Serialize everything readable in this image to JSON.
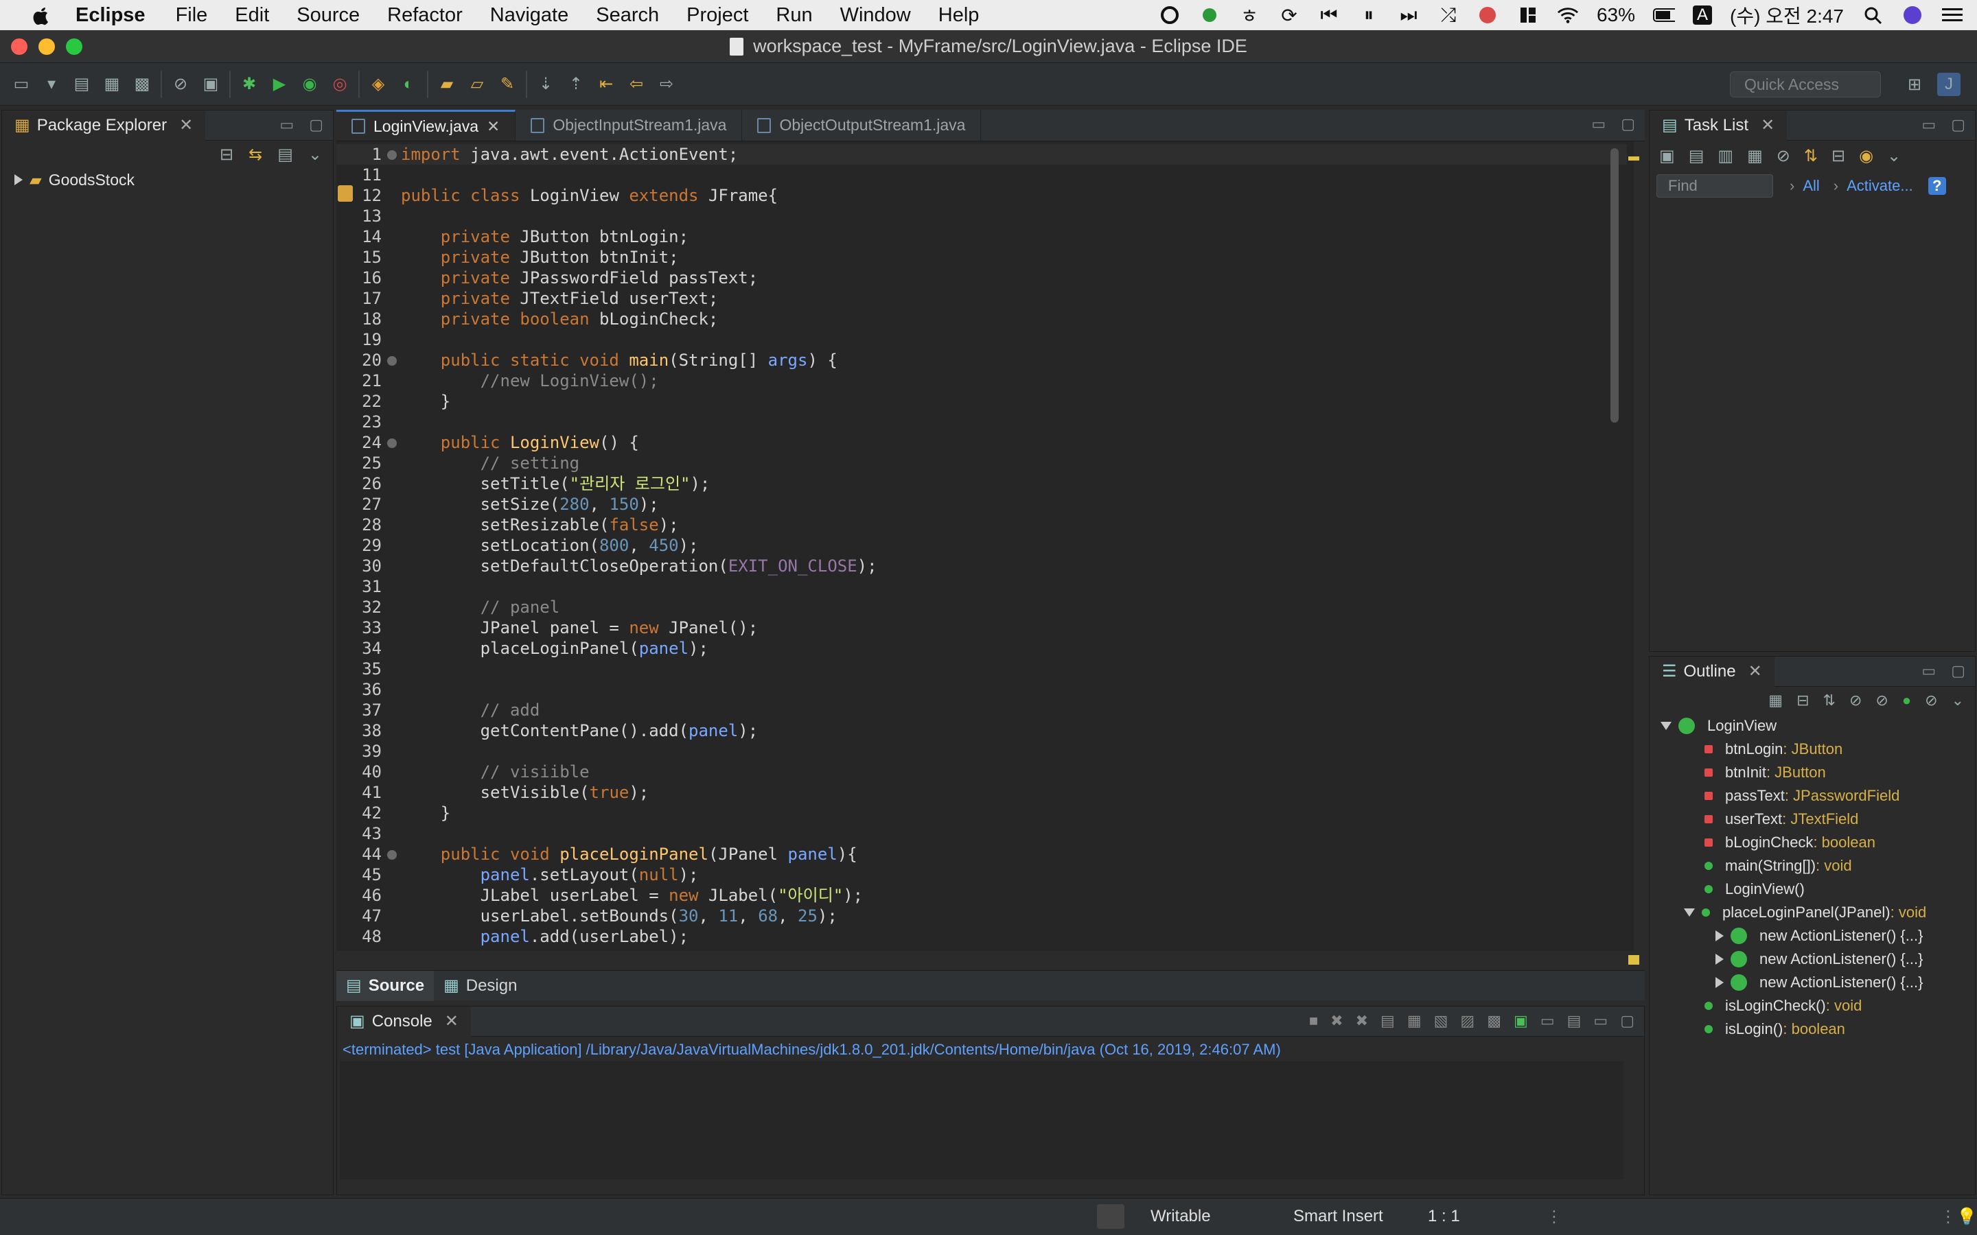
{
  "menubar": {
    "app_name": "Eclipse",
    "menus": [
      "File",
      "Edit",
      "Source",
      "Refactor",
      "Navigate",
      "Search",
      "Project",
      "Run",
      "Window",
      "Help"
    ],
    "battery": "63%",
    "input_source": "A",
    "clock": "(수) 오전 2:47"
  },
  "window": {
    "title": "workspace_test - MyFrame/src/LoginView.java - Eclipse IDE"
  },
  "toolbar": {
    "quick_access_placeholder": "Quick Access"
  },
  "package_explorer": {
    "title": "Package Explorer",
    "project": "GoodsStock"
  },
  "editor": {
    "tabs": [
      "LoginView.java",
      "ObjectInputStream1.java",
      "ObjectOutputStream1.java"
    ],
    "active_tab": 0,
    "bottom_tabs": [
      "Source",
      "Design"
    ],
    "lines": [
      {
        "n": "1",
        "fold": true,
        "tokens": [
          [
            "kw",
            "import"
          ],
          [
            "code",
            " java.awt.event.ActionEvent;"
          ]
        ]
      },
      {
        "n": "11",
        "tokens": []
      },
      {
        "n": "12",
        "tokens": [
          [
            "kw",
            "public class "
          ],
          [
            "code",
            "LoginView "
          ],
          [
            "kw",
            "extends "
          ],
          [
            "code",
            "JFrame{"
          ]
        ]
      },
      {
        "n": "13",
        "tokens": []
      },
      {
        "n": "14",
        "tokens": [
          [
            "code",
            "    "
          ],
          [
            "kw",
            "private "
          ],
          [
            "code",
            "JButton btnLogin;"
          ]
        ]
      },
      {
        "n": "15",
        "tokens": [
          [
            "code",
            "    "
          ],
          [
            "kw",
            "private "
          ],
          [
            "code",
            "JButton btnInit;"
          ]
        ]
      },
      {
        "n": "16",
        "tokens": [
          [
            "code",
            "    "
          ],
          [
            "kw",
            "private "
          ],
          [
            "code",
            "JPasswordField passText;"
          ]
        ]
      },
      {
        "n": "17",
        "tokens": [
          [
            "code",
            "    "
          ],
          [
            "kw",
            "private "
          ],
          [
            "code",
            "JTextField userText;"
          ]
        ]
      },
      {
        "n": "18",
        "tokens": [
          [
            "code",
            "    "
          ],
          [
            "kw",
            "private boolean "
          ],
          [
            "code",
            "bLoginCheck;"
          ]
        ]
      },
      {
        "n": "19",
        "tokens": []
      },
      {
        "n": "20",
        "fold": true,
        "tokens": [
          [
            "code",
            "    "
          ],
          [
            "kw",
            "public static void "
          ],
          [
            "fn",
            "main"
          ],
          [
            "code",
            "(String[] "
          ],
          [
            "par",
            "args"
          ],
          [
            "code",
            ") {"
          ]
        ]
      },
      {
        "n": "21",
        "tokens": [
          [
            "cm",
            "        //new LoginView();"
          ]
        ]
      },
      {
        "n": "22",
        "tokens": [
          [
            "code",
            "    }"
          ]
        ]
      },
      {
        "n": "23",
        "tokens": []
      },
      {
        "n": "24",
        "fold": true,
        "tokens": [
          [
            "code",
            "    "
          ],
          [
            "kw",
            "public "
          ],
          [
            "fn",
            "LoginView"
          ],
          [
            "code",
            "() {"
          ]
        ]
      },
      {
        "n": "25",
        "tokens": [
          [
            "cm",
            "        // setting"
          ]
        ]
      },
      {
        "n": "26",
        "tokens": [
          [
            "code",
            "        setTitle("
          ],
          [
            "str",
            "\"관리자 로그인\""
          ],
          [
            "code",
            ");"
          ]
        ]
      },
      {
        "n": "27",
        "tokens": [
          [
            "code",
            "        setSize("
          ],
          [
            "num",
            "280"
          ],
          [
            "code",
            ", "
          ],
          [
            "num",
            "150"
          ],
          [
            "code",
            ");"
          ]
        ]
      },
      {
        "n": "28",
        "tokens": [
          [
            "code",
            "        setResizable("
          ],
          [
            "kw",
            "false"
          ],
          [
            "code",
            ");"
          ]
        ]
      },
      {
        "n": "29",
        "tokens": [
          [
            "code",
            "        setLocation("
          ],
          [
            "num",
            "800"
          ],
          [
            "code",
            ", "
          ],
          [
            "num",
            "450"
          ],
          [
            "code",
            ");"
          ]
        ]
      },
      {
        "n": "30",
        "tokens": [
          [
            "code",
            "        setDefaultCloseOperation("
          ],
          [
            "fld",
            "EXIT_ON_CLOSE"
          ],
          [
            "code",
            ");"
          ]
        ]
      },
      {
        "n": "31",
        "tokens": []
      },
      {
        "n": "32",
        "tokens": [
          [
            "cm",
            "        // panel"
          ]
        ]
      },
      {
        "n": "33",
        "tokens": [
          [
            "code",
            "        JPanel panel = "
          ],
          [
            "kw",
            "new "
          ],
          [
            "code",
            "JPanel();"
          ]
        ]
      },
      {
        "n": "34",
        "tokens": [
          [
            "code",
            "        placeLoginPanel("
          ],
          [
            "par",
            "panel"
          ],
          [
            "code",
            ");"
          ]
        ]
      },
      {
        "n": "35",
        "tokens": []
      },
      {
        "n": "36",
        "tokens": []
      },
      {
        "n": "37",
        "tokens": [
          [
            "cm",
            "        // add"
          ]
        ]
      },
      {
        "n": "38",
        "tokens": [
          [
            "code",
            "        getContentPane().add("
          ],
          [
            "par",
            "panel"
          ],
          [
            "code",
            ");"
          ]
        ]
      },
      {
        "n": "39",
        "tokens": []
      },
      {
        "n": "40",
        "tokens": [
          [
            "cm",
            "        // visiible"
          ]
        ]
      },
      {
        "n": "41",
        "tokens": [
          [
            "code",
            "        setVisible("
          ],
          [
            "kw",
            "true"
          ],
          [
            "code",
            ");"
          ]
        ]
      },
      {
        "n": "42",
        "tokens": [
          [
            "code",
            "    }"
          ]
        ]
      },
      {
        "n": "43",
        "tokens": []
      },
      {
        "n": "44",
        "fold": true,
        "tokens": [
          [
            "code",
            "    "
          ],
          [
            "kw",
            "public void "
          ],
          [
            "fn",
            "placeLoginPanel"
          ],
          [
            "code",
            "(JPanel "
          ],
          [
            "par",
            "panel"
          ],
          [
            "code",
            "){"
          ]
        ]
      },
      {
        "n": "45",
        "tokens": [
          [
            "par",
            "        panel"
          ],
          [
            "code",
            ".setLayout("
          ],
          [
            "kw",
            "null"
          ],
          [
            "code",
            ");"
          ]
        ]
      },
      {
        "n": "46",
        "tokens": [
          [
            "code",
            "        JLabel userLabel = "
          ],
          [
            "kw",
            "new "
          ],
          [
            "code",
            "JLabel("
          ],
          [
            "str",
            "\"아이디\""
          ],
          [
            "code",
            ");"
          ]
        ]
      },
      {
        "n": "47",
        "tokens": [
          [
            "code",
            "        userLabel.setBounds("
          ],
          [
            "num",
            "30"
          ],
          [
            "code",
            ", "
          ],
          [
            "num",
            "11"
          ],
          [
            "code",
            ", "
          ],
          [
            "num",
            "68"
          ],
          [
            "code",
            ", "
          ],
          [
            "num",
            "25"
          ],
          [
            "code",
            ");"
          ]
        ]
      },
      {
        "n": "48",
        "tokens": [
          [
            "par",
            "        panel"
          ],
          [
            "code",
            ".add(userLabel);"
          ]
        ]
      }
    ]
  },
  "task_list": {
    "title": "Task List",
    "find_placeholder": "Find",
    "all_label": "All",
    "activate_label": "Activate..."
  },
  "outline": {
    "title": "Outline",
    "items": [
      {
        "label": "LoginView",
        "type": "",
        "kind": "class",
        "caret": "down"
      },
      {
        "label": "btnLogin",
        "type": " : JButton",
        "kind": "field"
      },
      {
        "label": "btnInit",
        "type": " : JButton",
        "kind": "field"
      },
      {
        "label": "passText",
        "type": " : JPasswordField",
        "kind": "field"
      },
      {
        "label": "userText",
        "type": " : JTextField",
        "kind": "field"
      },
      {
        "label": "bLoginCheck",
        "type": " : boolean",
        "kind": "field"
      },
      {
        "label": "main(String[])",
        "type": " : void",
        "kind": "method"
      },
      {
        "label": "LoginView()",
        "type": "",
        "kind": "method"
      },
      {
        "label": "placeLoginPanel(JPanel)",
        "type": " : void",
        "kind": "method",
        "caret": "down"
      },
      {
        "label": "new ActionListener() {...}",
        "type": "",
        "kind": "anon",
        "caret": "right"
      },
      {
        "label": "new ActionListener() {...}",
        "type": "",
        "kind": "anon",
        "caret": "right"
      },
      {
        "label": "new ActionListener() {...}",
        "type": "",
        "kind": "anon",
        "caret": "right"
      },
      {
        "label": "isLoginCheck()",
        "type": " : void",
        "kind": "method"
      },
      {
        "label": "isLogin()",
        "type": " : boolean",
        "kind": "method"
      }
    ]
  },
  "console": {
    "title": "Console",
    "status": "<terminated> test [Java Application] /Library/Java/JavaVirtualMachines/jdk1.8.0_201.jdk/Contents/Home/bin/java (Oct 16, 2019, 2:46:07 AM)"
  },
  "statusbar": {
    "writable": "Writable",
    "insert_mode": "Smart Insert",
    "position": "1 : 1"
  }
}
